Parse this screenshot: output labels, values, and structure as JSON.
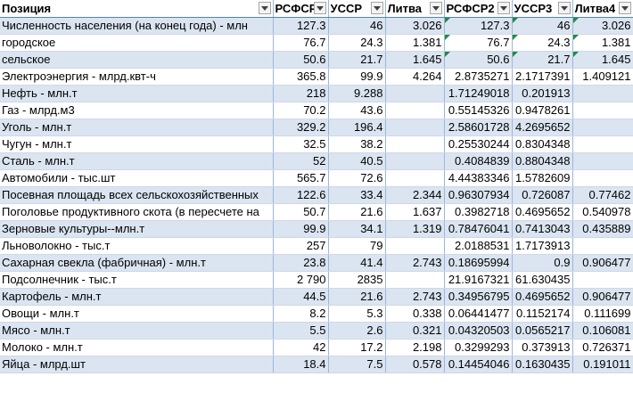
{
  "columns": [
    "Позиция",
    "РСФСР",
    "УССР",
    "Литва",
    "РСФСР2",
    "УССР3",
    "Литва4"
  ],
  "rows": [
    {
      "label": "Численность населения (на конец года) - млн",
      "values": [
        "127.3",
        "46",
        "3.026",
        "127.3",
        "46",
        "3.026"
      ],
      "flags": [
        false,
        false,
        false,
        true,
        true,
        true
      ]
    },
    {
      "label": "городское",
      "values": [
        "76.7",
        "24.3",
        "1.381",
        "76.7",
        "24.3",
        "1.381"
      ],
      "flags": [
        false,
        false,
        false,
        true,
        true,
        true
      ]
    },
    {
      "label": "сельское",
      "values": [
        "50.6",
        "21.7",
        "1.645",
        "50.6",
        "21.7",
        "1.645"
      ],
      "flags": [
        false,
        false,
        false,
        true,
        true,
        true
      ]
    },
    {
      "label": "Электроэнергия - млрд.квт-ч",
      "values": [
        "365.8",
        "99.9",
        "4.264",
        "2.8735271",
        "2.1717391",
        "1.409121"
      ],
      "flags": [
        false,
        false,
        false,
        false,
        false,
        false
      ]
    },
    {
      "label": "Нефть - млн.т",
      "values": [
        "218",
        "9.288",
        "",
        "1.71249018",
        "0.201913",
        ""
      ],
      "flags": [
        false,
        false,
        false,
        false,
        false,
        false
      ]
    },
    {
      "label": "Газ - млрд.м3",
      "values": [
        "70.2",
        "43.6",
        "",
        "0.55145326",
        "0.9478261",
        ""
      ],
      "flags": [
        false,
        false,
        false,
        false,
        false,
        false
      ]
    },
    {
      "label": "Уголь - млн.т",
      "values": [
        "329.2",
        "196.4",
        "",
        "2.58601728",
        "4.2695652",
        ""
      ],
      "flags": [
        false,
        false,
        false,
        false,
        false,
        false
      ]
    },
    {
      "label": "Чугун - млн.т",
      "values": [
        "32.5",
        "38.2",
        "",
        "0.25530244",
        "0.8304348",
        ""
      ],
      "flags": [
        false,
        false,
        false,
        false,
        false,
        false
      ]
    },
    {
      "label": "Сталь - млн.т",
      "values": [
        "52",
        "40.5",
        "",
        "0.4084839",
        "0.8804348",
        ""
      ],
      "flags": [
        false,
        false,
        false,
        false,
        false,
        false
      ]
    },
    {
      "label": "Автомобили - тыс.шт",
      "values": [
        "565.7",
        "72.6",
        "",
        "4.44383346",
        "1.5782609",
        ""
      ],
      "flags": [
        false,
        false,
        false,
        false,
        false,
        false
      ]
    },
    {
      "label": "Посевная площадь всех сельскохозяйственных",
      "values": [
        "122.6",
        "33.4",
        "2.344",
        "0.96307934",
        "0.726087",
        "0.77462"
      ],
      "flags": [
        false,
        false,
        false,
        false,
        false,
        false
      ]
    },
    {
      "label": "Поголовье продуктивного скота (в пересчете на",
      "values": [
        "50.7",
        "21.6",
        "1.637",
        "0.3982718",
        "0.4695652",
        "0.540978"
      ],
      "flags": [
        false,
        false,
        false,
        false,
        false,
        false
      ]
    },
    {
      "label": "Зерновые культуры--млн.т",
      "values": [
        "99.9",
        "34.1",
        "1.319",
        "0.78476041",
        "0.7413043",
        "0.435889"
      ],
      "flags": [
        false,
        false,
        false,
        false,
        false,
        false
      ]
    },
    {
      "label": "Льноволокно - тыс.т",
      "values": [
        "257",
        "79",
        "",
        "2.0188531",
        "1.7173913",
        ""
      ],
      "flags": [
        false,
        false,
        false,
        false,
        false,
        false
      ]
    },
    {
      "label": "Сахарная свекла (фабричная) - млн.т",
      "values": [
        "23.8",
        "41.4",
        "2.743",
        "0.18695994",
        "0.9",
        "0.906477"
      ],
      "flags": [
        false,
        false,
        false,
        false,
        false,
        false
      ]
    },
    {
      "label": "Подсолнечник - тыс.т",
      "values": [
        "2 790",
        "2835",
        "",
        "21.9167321",
        "61.630435",
        ""
      ],
      "flags": [
        false,
        false,
        false,
        false,
        false,
        false
      ]
    },
    {
      "label": "Картофель - млн.т",
      "values": [
        "44.5",
        "21.6",
        "2.743",
        "0.34956795",
        "0.4695652",
        "0.906477"
      ],
      "flags": [
        false,
        false,
        false,
        false,
        false,
        false
      ]
    },
    {
      "label": "Овощи - млн.т",
      "values": [
        "8.2",
        "5.3",
        "0.338",
        "0.06441477",
        "0.1152174",
        "0.111699"
      ],
      "flags": [
        false,
        false,
        false,
        false,
        false,
        false
      ]
    },
    {
      "label": "Мясо - млн.т",
      "values": [
        "5.5",
        "2.6",
        "0.321",
        "0.04320503",
        "0.0565217",
        "0.106081"
      ],
      "flags": [
        false,
        false,
        false,
        false,
        false,
        false
      ]
    },
    {
      "label": "Молоко - млн.т",
      "values": [
        "42",
        "17.2",
        "2.198",
        "0.3299293",
        "0.373913",
        "0.726371"
      ],
      "flags": [
        false,
        false,
        false,
        false,
        false,
        false
      ]
    },
    {
      "label": "Яйца - млрд.шт",
      "values": [
        "18.4",
        "7.5",
        "0.578",
        "0.14454046",
        "0.1630435",
        "0.191011"
      ],
      "flags": [
        false,
        false,
        false,
        false,
        false,
        false
      ]
    }
  ],
  "icons": {
    "filter": "dropdown-arrow-icon",
    "error_flag": "green-triangle-icon"
  },
  "colors": {
    "band": "#dbe5f1",
    "header_line": "#4f81bd",
    "flag": "#1e8c3a"
  }
}
